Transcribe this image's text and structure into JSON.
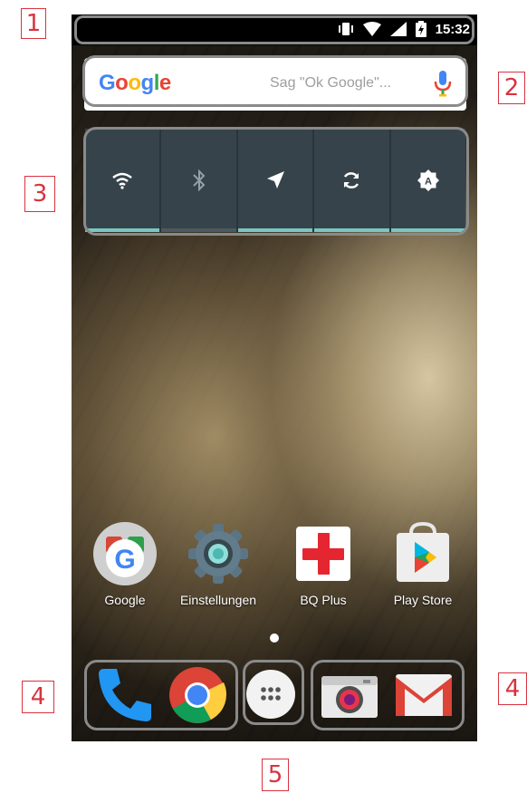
{
  "callouts": [
    "1",
    "2",
    "3",
    "4",
    "4",
    "5"
  ],
  "statusbar": {
    "time": "15:32",
    "icons": [
      "vibrate-icon",
      "wifi-icon",
      "cell-signal-icon",
      "battery-charging-icon"
    ]
  },
  "search": {
    "logo": "Google",
    "placeholder": "Sag \"Ok Google\"...",
    "mic_icon": "mic-icon"
  },
  "quick_toggles": [
    {
      "name": "wifi",
      "icon": "wifi-icon",
      "active": true
    },
    {
      "name": "bluetooth",
      "icon": "bluetooth-icon",
      "active": false
    },
    {
      "name": "location",
      "icon": "location-icon",
      "active": true
    },
    {
      "name": "auto-rotate",
      "icon": "rotate-icon",
      "active": true
    },
    {
      "name": "auto-brightness",
      "icon": "brightness-icon",
      "active": true
    }
  ],
  "apps": [
    {
      "label": "Google",
      "icon": "google-folder-icon"
    },
    {
      "label": "Einstellungen",
      "icon": "settings-icon"
    },
    {
      "label": "BQ Plus",
      "icon": "bq-plus-icon"
    },
    {
      "label": "Play Store",
      "icon": "play-store-icon"
    }
  ],
  "dock": [
    {
      "name": "phone",
      "icon": "phone-icon"
    },
    {
      "name": "chrome",
      "icon": "chrome-icon"
    },
    {
      "name": "app-drawer",
      "icon": "app-drawer-icon"
    },
    {
      "name": "camera",
      "icon": "camera-icon"
    },
    {
      "name": "gmail",
      "icon": "gmail-icon"
    }
  ],
  "colors": {
    "accent": "#78c7c2",
    "callout": "#d8333f",
    "toggle_bg": "#36434a"
  }
}
